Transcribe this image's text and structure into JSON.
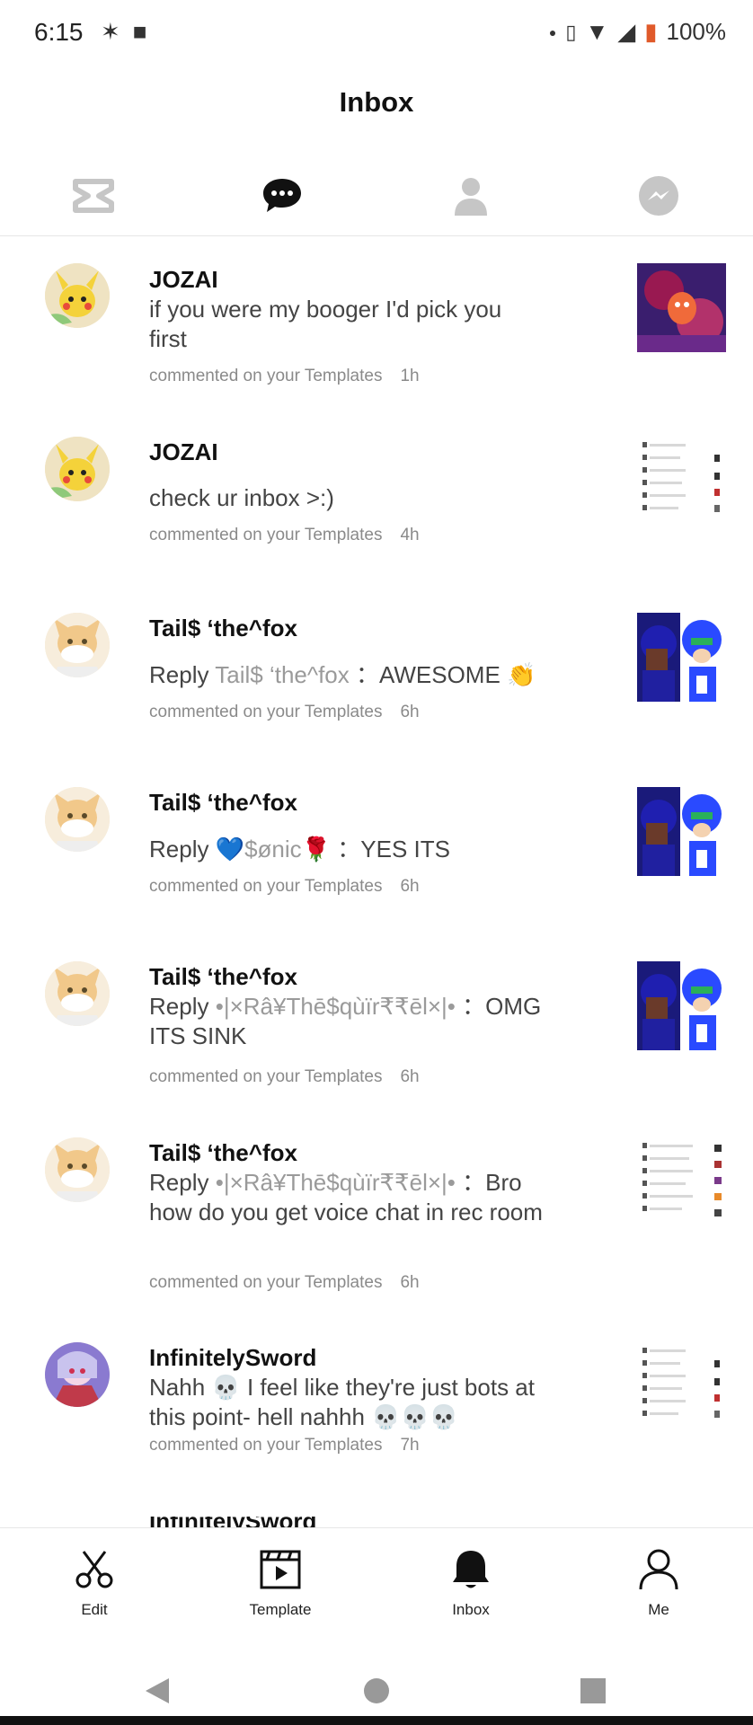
{
  "status": {
    "time": "6:15",
    "battery": "100%"
  },
  "header": {
    "title": "Inbox"
  },
  "top_icons": [
    "capcut-logo-icon",
    "chat-bubble-icon",
    "person-icon",
    "messenger-icon"
  ],
  "items": [
    {
      "user": "JOZAI",
      "reply_label": "",
      "reply_from": "",
      "text": "if you were my booger I'd pick you first",
      "meta": "commented on your Templates",
      "ago": "1h",
      "avatar": "pikachu",
      "thumb": "red-art"
    },
    {
      "user": "JOZAI",
      "reply_label": "",
      "reply_from": "",
      "text": "check ur inbox >:)",
      "meta": "commented on your Templates",
      "ago": "4h",
      "avatar": "pikachu",
      "thumb": "list"
    },
    {
      "user": "Tail$ ‘the^fox",
      "reply_label": "Reply",
      "reply_from": "Tail$ ‘the^fox",
      "text": "AWESOME 👏",
      "meta": "commented on your Templates",
      "ago": "6h",
      "avatar": "fox",
      "thumb": "blue-art"
    },
    {
      "user": "Tail$ ‘the^fox",
      "reply_label": "Reply",
      "reply_from": "💙$ønic🌹",
      "text": "YES ITS",
      "meta": "commented on your Templates",
      "ago": "6h",
      "avatar": "fox",
      "thumb": "blue-art"
    },
    {
      "user": "Tail$ ‘the^fox",
      "reply_label": "Reply",
      "reply_from": "•|×Râ¥Thē$qùïr₹₹ēl×|•",
      "text": "OMG ITS SINK",
      "meta": "commented on your Templates",
      "ago": "6h",
      "avatar": "fox",
      "thumb": "blue-art"
    },
    {
      "user": "Tail$ ‘the^fox",
      "reply_label": "Reply",
      "reply_from": "•|×Râ¥Thē$qùïr₹₹ēl×|•",
      "text": "Bro how do you get voice chat in rec room",
      "meta": "commented on your Templates",
      "ago": "6h",
      "avatar": "fox",
      "thumb": "list"
    },
    {
      "user": "InfinitelySword",
      "reply_label": "",
      "reply_from": "",
      "text": "Nahh 💀 I feel like they're just bots at this point- hell nahhh 💀💀💀",
      "meta": "commented on your Templates",
      "ago": "7h",
      "avatar": "anime",
      "thumb": "list"
    }
  ],
  "partial_item": {
    "user": "InfinitelySword"
  },
  "bottom_nav": [
    {
      "label": "Edit",
      "icon": "scissors-icon"
    },
    {
      "label": "Template",
      "icon": "template-icon"
    },
    {
      "label": "Inbox",
      "icon": "bell-icon"
    },
    {
      "label": "Me",
      "icon": "person-outline-icon"
    }
  ],
  "colors": {
    "accent": "#111111",
    "muted": "#8a8a8a"
  }
}
